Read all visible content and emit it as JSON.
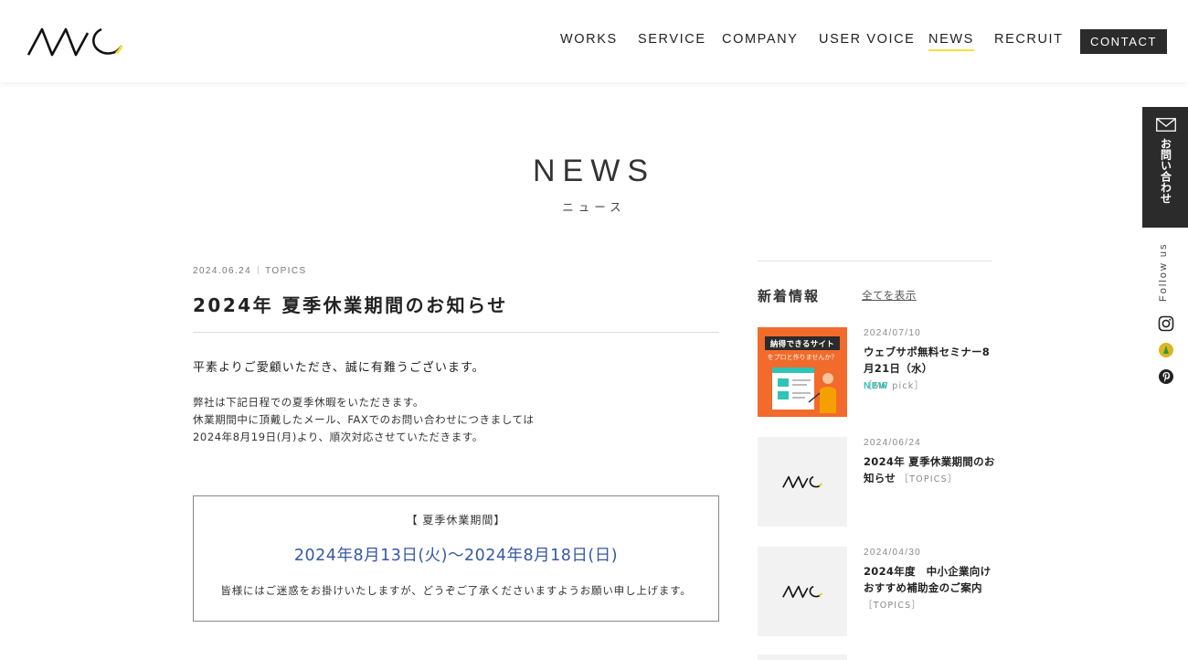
{
  "header": {
    "nav": [
      "WORKS",
      "SERVICE",
      "COMPANY",
      "USER VOICE",
      "NEWS",
      "RECRUIT"
    ],
    "active": "NEWS",
    "contact_label": "CONTACT"
  },
  "page": {
    "title": "NEWS",
    "subtitle": "ニュース"
  },
  "article": {
    "date": "2024.06.24",
    "category": "TOPICS",
    "title": "2024年 夏季休業期間のお知らせ",
    "lead": "平素よりご愛顧いただき、誠に有難うございます。",
    "body_lines": [
      "弊社は下記日程での夏季休暇をいただきます。",
      "休業期間中に頂戴したメール、FAXでのお問い合わせにつきましては",
      "2024年8月19日(月)より、順次対応させていただきます。"
    ],
    "notice": {
      "label": "【 夏季休業期間】",
      "dates": "2024年8月13日(火)〜2024年8月18日(日)",
      "text": "皆様にはご迷惑をお掛けいたしますが、どうぞご了承くださいますようお願い申し上げます。"
    }
  },
  "sidebar": {
    "heading": "新着情報",
    "view_all": "全てを表示",
    "items": [
      {
        "date": "2024/07/10",
        "title": "ウェブサポ無料セミナー8月21日（水）",
        "category": "［MP pick］",
        "badge": "NEW",
        "thumb_banner": "納得できるサイト",
        "thumb_sub": "をプロと作りませんか？"
      },
      {
        "date": "2024/06/24",
        "title": "2024年 夏季休業期間のお知らせ",
        "category": "［TOPICS］"
      },
      {
        "date": "2024/04/30",
        "title": "2024年度　中小企業向けおすすめ補助金のご案内",
        "category": "［TOPICS］"
      }
    ]
  },
  "float": {
    "contact_label": "お問い合わせ",
    "follow_label": "Follow us"
  },
  "colors": {
    "accent": "#f4e23a",
    "date_blue": "#3657a6",
    "new_badge": "#2ec4b6",
    "dark": "#2b2b2b"
  }
}
